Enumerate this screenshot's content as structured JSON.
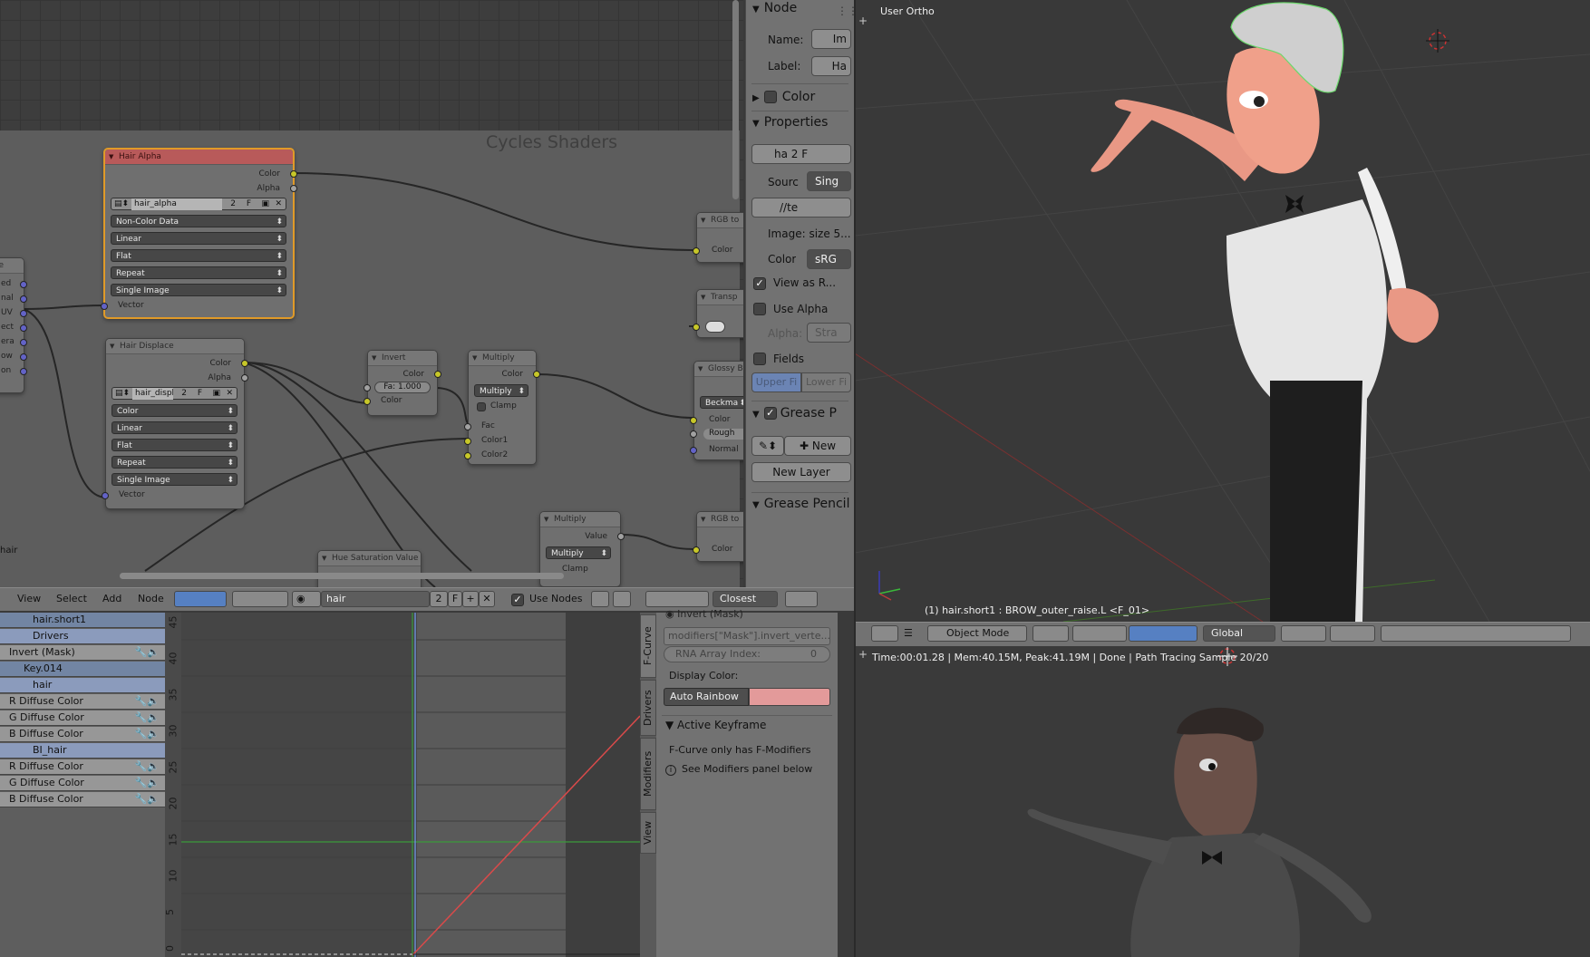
{
  "node_editor": {
    "frame_label": "Cycles Shaders",
    "frame_corner_text": "hair",
    "left_node_sockets": [
      "te",
      "ed",
      "nal",
      "UV",
      "ect",
      "era",
      "ow",
      "on"
    ],
    "hair_alpha": {
      "title": "Hair Alpha",
      "outputs": [
        "Color",
        "Alpha"
      ],
      "image": "hair_alpha",
      "users": "2",
      "fake": "F",
      "dropdowns": [
        "Non-Color Data",
        "Linear",
        "Flat",
        "Repeat",
        "Single Image"
      ],
      "input": "Vector"
    },
    "hair_displace": {
      "title": "Hair Displace",
      "outputs": [
        "Color",
        "Alpha"
      ],
      "image": "hair_displa",
      "users": "2",
      "fake": "F",
      "dropdowns": [
        "Color",
        "Linear",
        "Flat",
        "Repeat",
        "Single Image"
      ],
      "input": "Vector"
    },
    "invert": {
      "title": "Invert",
      "output": "Color",
      "fac": "Fa: 1.000",
      "input": "Color"
    },
    "multiply1": {
      "title": "Multiply",
      "output": "Color",
      "mode": "Multiply",
      "clamp": "Clamp",
      "inputs": [
        "Fac",
        "Color1",
        "Color2"
      ]
    },
    "multiply2": {
      "title": "Multiply",
      "output": "Value",
      "mode": "Multiply",
      "clamp": "Clamp"
    },
    "hue_sat": {
      "title": "Hue Saturation Value"
    },
    "rgb1": {
      "title": "RGB to",
      "output": "Color"
    },
    "transp": {
      "title": "Transp"
    },
    "glossy": {
      "title": "Glossy B",
      "dist": "Beckma",
      "rough": "Rough",
      "inputs": [
        "Color",
        "Normal"
      ]
    },
    "rgb2": {
      "title": "RGB to",
      "output": "Color"
    }
  },
  "node_header": {
    "menus": [
      "View",
      "Select",
      "Add",
      "Node"
    ],
    "material": "hair",
    "users": "2",
    "fake": "F",
    "use_nodes": "Use Nodes",
    "snap": "Closest"
  },
  "npanel": {
    "node_title": "Node",
    "name_label": "Name:",
    "name_value": "Im",
    "label_label": "Label:",
    "label_value": "Ha",
    "color_title": "Color",
    "properties_title": "Properties",
    "img_name": "ha",
    "img_users": "2",
    "img_fake": "F",
    "source_label": "Sourc",
    "source_value": "Sing",
    "file_path": "//te",
    "image_size": "Image: size 5...",
    "colorspace_label": "Color",
    "colorspace_value": "sRG",
    "view_as_render": "View as R...",
    "use_alpha": "Use Alpha",
    "alpha_label": "Alpha:",
    "alpha_value": "Stra",
    "fields": "Fields",
    "upper_field": "Upper Fi",
    "lower_field": "Lower Fi",
    "grease_title": "Grease P",
    "new_btn": "New",
    "new_layer_btn": "New Layer",
    "grease_pencil2": "Grease Pencil"
  },
  "view3d": {
    "label": "User Ortho",
    "object_info": "(1) hair.short1 : BROW_outer_raise.L <F_01>",
    "mode": "Object Mode",
    "orientation": "Global"
  },
  "render": {
    "status": "Time:00:01.28 | Mem:40.15M, Peak:41.19M | Done | Path Tracing Sample 20/20"
  },
  "channels": [
    {
      "label": "hair.short1",
      "style": "blue",
      "icons": ""
    },
    {
      "label": "Drivers",
      "style": "lb",
      "icons": ""
    },
    {
      "label": "Invert (Mask)",
      "style": "gray",
      "icons": "🔧🔈"
    },
    {
      "label": "Key.014",
      "style": "blue",
      "icons": ""
    },
    {
      "label": "hair",
      "style": "lb",
      "icons": ""
    },
    {
      "label": "R Diffuse Color",
      "style": "gray",
      "icons": "🔧🔈"
    },
    {
      "label": "G Diffuse Color",
      "style": "gray",
      "icons": "🔧🔈"
    },
    {
      "label": "B Diffuse Color",
      "style": "gray",
      "icons": "🔧🔈"
    },
    {
      "label": "BI_hair",
      "style": "lb",
      "icons": ""
    },
    {
      "label": "R Diffuse Color",
      "style": "gray",
      "icons": "🔧🔈"
    },
    {
      "label": "G Diffuse Color",
      "style": "gray",
      "icons": "🔧🔈"
    },
    {
      "label": "B Diffuse Color",
      "style": "gray",
      "icons": "🔧🔈"
    }
  ],
  "graph": {
    "y_ticks": [
      "45",
      "40",
      "35",
      "30",
      "25",
      "20",
      "15",
      "10",
      "5",
      "0"
    ],
    "tabs": [
      "F-Curve",
      "Drivers",
      "Modifiers",
      "View"
    ]
  },
  "gprops": {
    "header_cut": "Invert (Mask)",
    "data_path": "modifiers[\"Mask\"].invert_verte...",
    "rna_label": "RNA Array Index:",
    "rna_value": "0",
    "display_color_label": "Display Color:",
    "display_color_mode": "Auto Rainbow",
    "display_color": "#e39a9a",
    "active_keyframe": "Active Keyframe",
    "fcurve_note": "F-Curve only has F-Modifiers",
    "modifiers_note": "See Modifiers panel below"
  }
}
